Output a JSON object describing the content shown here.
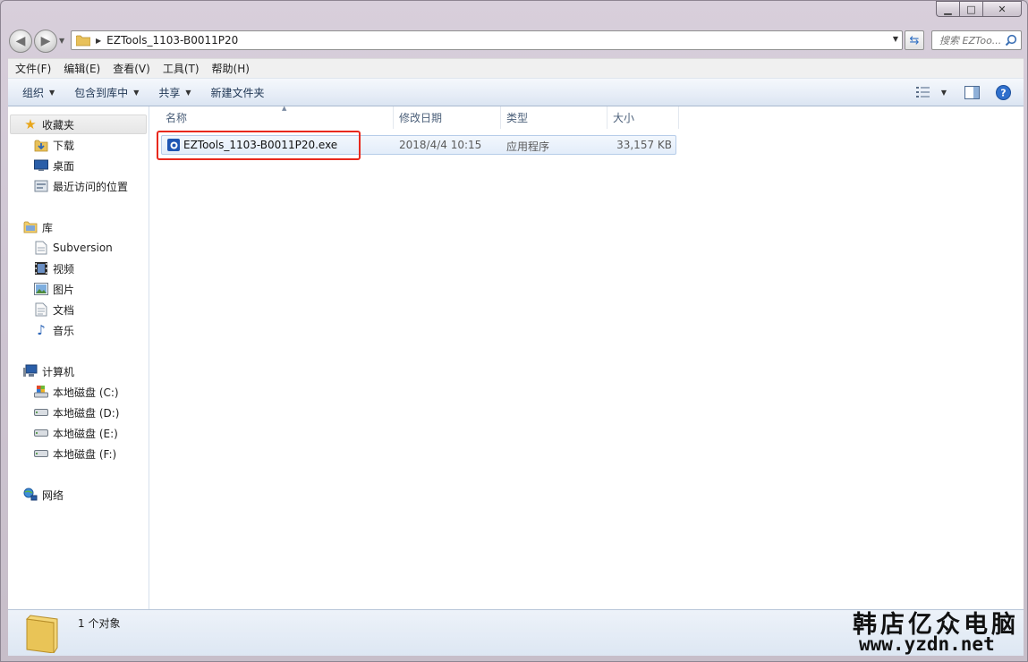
{
  "window": {
    "controls": {
      "minimize": "▁",
      "maximize": "□",
      "close": "✕"
    }
  },
  "address": {
    "path": "EZTools_1103-B0011P20",
    "search_placeholder": "搜索 EZToo..."
  },
  "menu": {
    "items": [
      "文件(F)",
      "编辑(E)",
      "查看(V)",
      "工具(T)",
      "帮助(H)"
    ]
  },
  "commands": {
    "organize": "组织",
    "include_in_library": "包含到库中",
    "share": "共享",
    "new_folder": "新建文件夹"
  },
  "sidebar": {
    "favorites": {
      "label": "收藏夹",
      "items": [
        "下载",
        "桌面",
        "最近访问的位置"
      ]
    },
    "libraries": {
      "label": "库",
      "items": [
        "Subversion",
        "视频",
        "图片",
        "文档",
        "音乐"
      ]
    },
    "computer": {
      "label": "计算机",
      "items": [
        "本地磁盘 (C:)",
        "本地磁盘 (D:)",
        "本地磁盘 (E:)",
        "本地磁盘 (F:)"
      ]
    },
    "network": {
      "label": "网络"
    }
  },
  "columns": {
    "name": "名称",
    "modified": "修改日期",
    "type": "类型",
    "size": "大小"
  },
  "files": [
    {
      "name": "EZTools_1103-B0011P20.exe",
      "modified": "2018/4/4 10:15",
      "type": "应用程序",
      "size": "33,157 KB",
      "icon": "exe-app-icon"
    }
  ],
  "status": {
    "count": "1 个对象"
  },
  "watermark": {
    "line1": "韩店亿众电脑",
    "line2": "www.yzdn.net"
  },
  "colors": {
    "highlight_box": "#e8291d",
    "selection_fill": "#e3edfa",
    "command_bar": "#dbe5f2"
  }
}
